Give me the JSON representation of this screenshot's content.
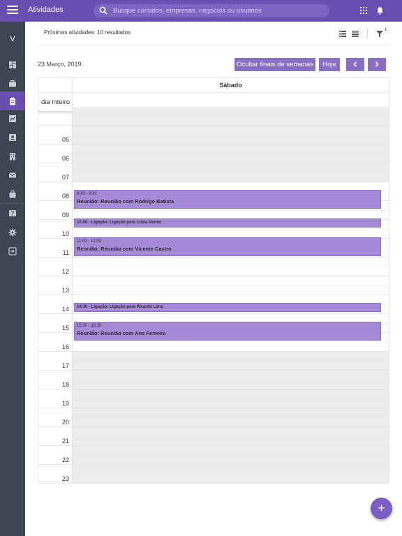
{
  "topbar": {
    "title": "Atividades",
    "search_placeholder": "Busque contatos, empresas, negócios ou usuários",
    "icons": [
      "menu-icon",
      "search-icon",
      "apps-grid-icon",
      "bell-icon"
    ]
  },
  "sidebar": {
    "avatar_letter": "V",
    "items": [
      {
        "name": "dashboard",
        "icon": "dashboard-icon",
        "active": false
      },
      {
        "name": "deals",
        "icon": "briefcase-icon",
        "active": false
      },
      {
        "name": "activities",
        "icon": "clipboard-icon",
        "active": true
      },
      {
        "name": "reports",
        "icon": "chart-icon",
        "active": false
      },
      {
        "name": "contacts",
        "icon": "contact-card-icon",
        "active": false
      },
      {
        "name": "companies",
        "icon": "building-icon",
        "active": false
      },
      {
        "name": "messages",
        "icon": "mail-icon",
        "active": false
      },
      {
        "name": "products",
        "icon": "bag-icon",
        "active": false
      },
      {
        "name": "help",
        "icon": "help-icon",
        "active": false
      },
      {
        "name": "settings",
        "icon": "gear-icon",
        "active": false
      },
      {
        "name": "logout",
        "icon": "exit-icon",
        "active": false
      }
    ]
  },
  "toolbar": {
    "results_text": "Próximas atividades: 10 resultados",
    "filter_count": "1"
  },
  "calendar": {
    "date": "23 Março, 2019",
    "hide_weekends_label": "Ocultar finais de semanas",
    "today_label": "Hoje",
    "day_name": "Sábado",
    "allday_label": "dia inteiro",
    "hours": [
      "",
      "05",
      "06",
      "07",
      "08",
      "09",
      "10",
      "11",
      "12",
      "13",
      "14",
      "15",
      "16",
      "17",
      "18",
      "19",
      "20",
      "21",
      "22",
      "23"
    ],
    "events": [
      {
        "time": "8:30 - 9:30",
        "title": "Reunião: Reunião com Rodrigo Batista"
      },
      {
        "line": "10:00 - Ligação: Ligação para Lúcia Nunes"
      },
      {
        "time": "11:00 - 12:00",
        "title": "Reunião: Reunião com Vicente Castro"
      },
      {
        "line": "14:30 - Ligação: Ligação para Ricardo Lima"
      },
      {
        "time": "15:30 - 16:30",
        "title": "Reunião: Reunião com Ana Ferreira"
      }
    ]
  },
  "colors": {
    "primary": "#6a4fb3",
    "sidebar": "#3d4550",
    "event": "#a58ad8",
    "button": "#8b6fc7"
  }
}
